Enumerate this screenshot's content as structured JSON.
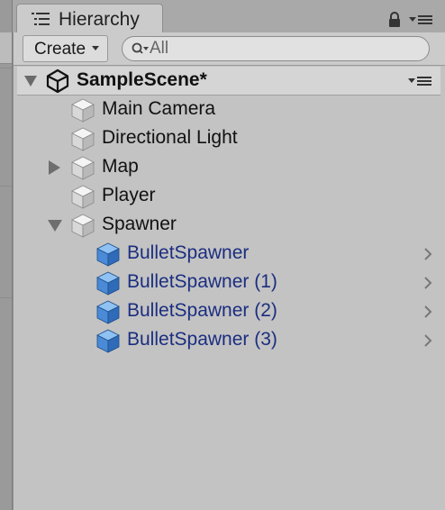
{
  "window": {
    "tab_label": "Hierarchy",
    "icons": {
      "tab": "hierarchy-list-icon",
      "lock": "lock-icon",
      "menu": "tab-menu-icon"
    }
  },
  "toolbar": {
    "create_label": "Create",
    "search_placeholder": "All"
  },
  "scene": {
    "name": "SampleScene*",
    "expanded": true,
    "icon": "unity-logo-icon"
  },
  "hierarchy": [
    {
      "label": "Main Camera",
      "depth": 0,
      "foldout": "none",
      "prefab": false
    },
    {
      "label": "Directional Light",
      "depth": 0,
      "foldout": "none",
      "prefab": false
    },
    {
      "label": "Map",
      "depth": 0,
      "foldout": "collapsed",
      "prefab": false
    },
    {
      "label": "Player",
      "depth": 0,
      "foldout": "none",
      "prefab": false
    },
    {
      "label": "Spawner",
      "depth": 0,
      "foldout": "expanded",
      "prefab": false
    },
    {
      "label": "BulletSpawner",
      "depth": 1,
      "foldout": "none",
      "prefab": true
    },
    {
      "label": "BulletSpawner (1)",
      "depth": 1,
      "foldout": "none",
      "prefab": true
    },
    {
      "label": "BulletSpawner (2)",
      "depth": 1,
      "foldout": "none",
      "prefab": true
    },
    {
      "label": "BulletSpawner (3)",
      "depth": 1,
      "foldout": "none",
      "prefab": true
    }
  ],
  "colors": {
    "prefab_text": "#1b2e80",
    "gameobject_cube": "#e8e8e8",
    "prefab_cube": "#4f8fd6"
  }
}
